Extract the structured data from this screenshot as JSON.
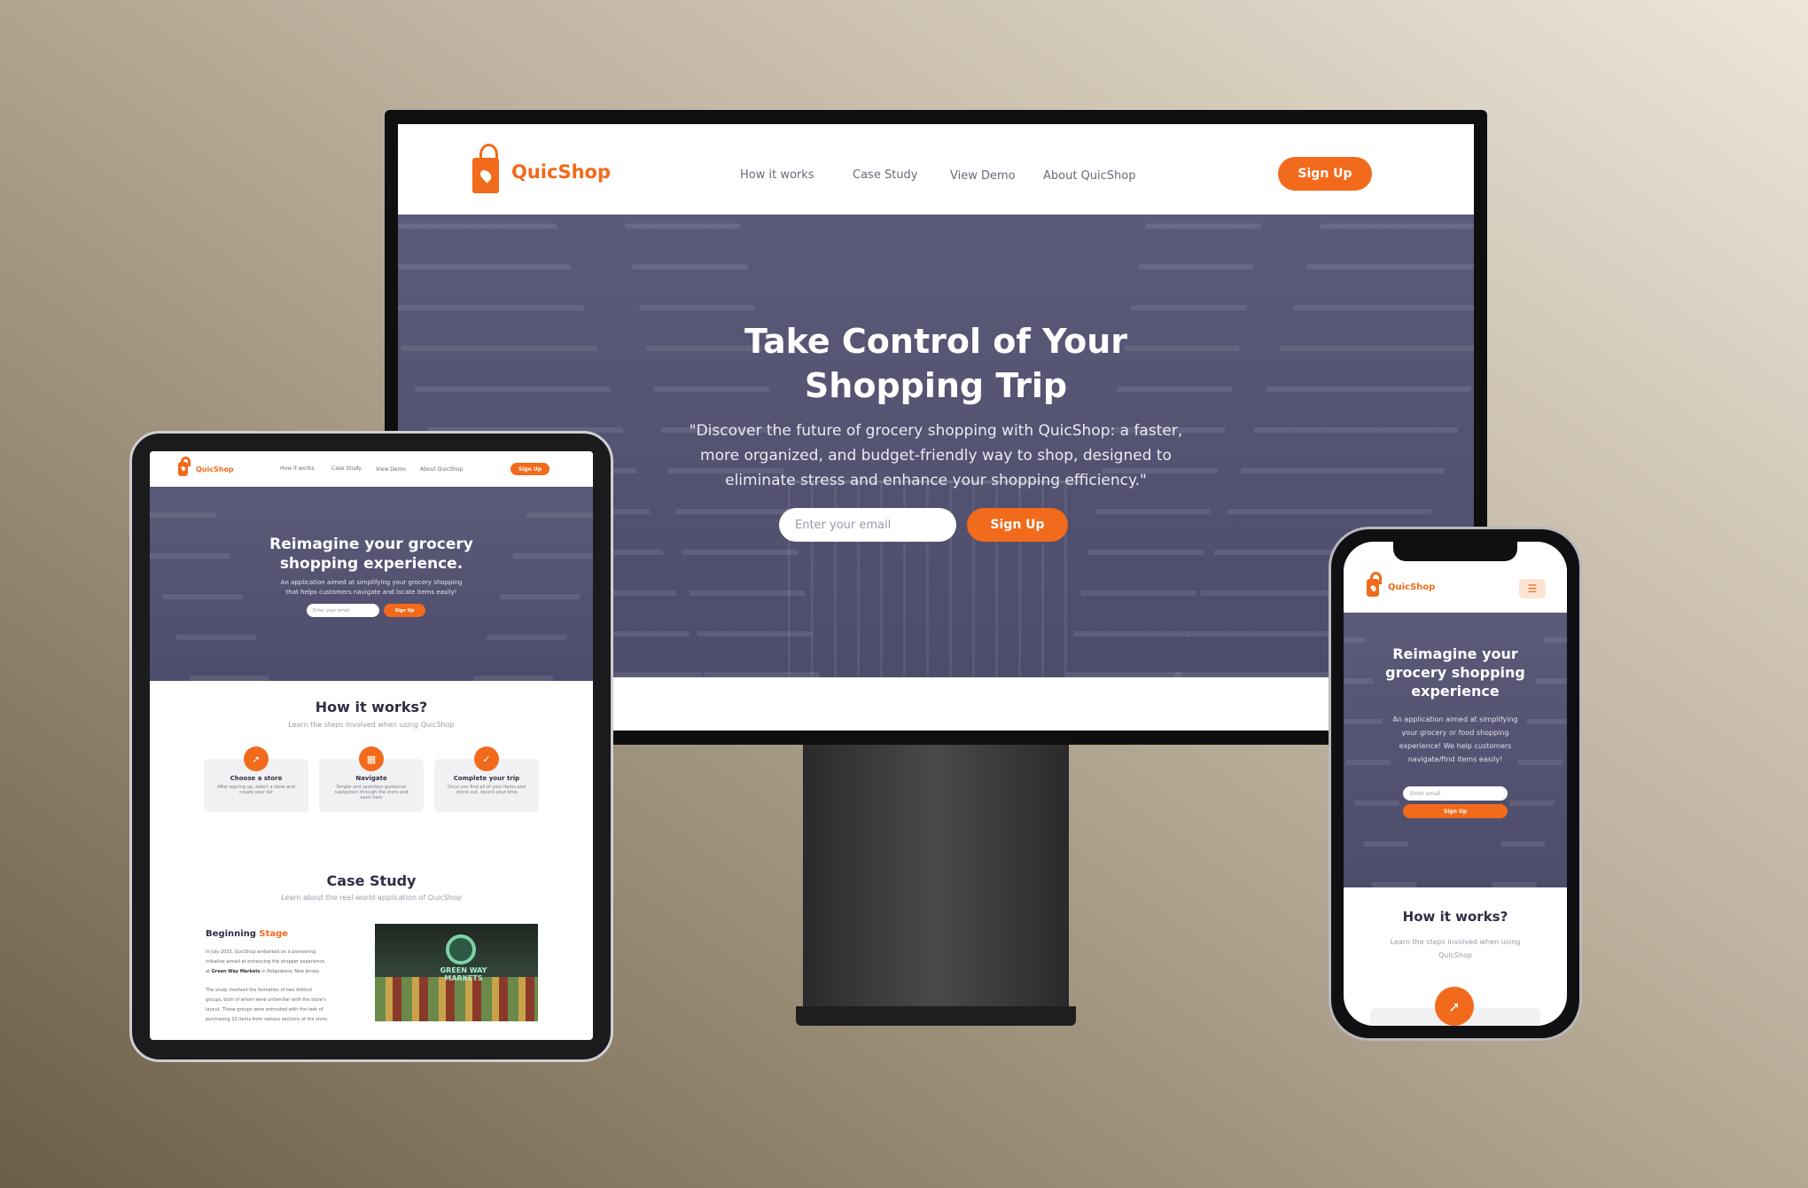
{
  "brand": {
    "name": "QuicShop"
  },
  "desktop": {
    "nav": [
      "How it works",
      "Case Study",
      "View Demo",
      "About QuicShop"
    ],
    "signup": "Sign Up",
    "hero": {
      "title_line1": "Take Control of Your",
      "title_line2": "Shopping Trip",
      "line1": "\"Discover the future of grocery shopping with QuicShop: a faster,",
      "line2": "more organized, and budget-friendly way to shop, designed to",
      "line3": "eliminate stress and enhance your shopping efficiency.\"",
      "email_placeholder": "Enter your email",
      "cta": "Sign Up"
    }
  },
  "tablet": {
    "nav": [
      "How it works",
      "Case Study",
      "View Demo",
      "About QuicShop"
    ],
    "signup": "Sign Up",
    "hero": {
      "title_line1": "Reimagine your grocery",
      "title_line2": "shopping experience.",
      "sub_line1": "An application aimed at simplifying your grocery shopping",
      "sub_line2": "that helps customers navigate and locate items easily!",
      "email_placeholder": "Enter your email",
      "cta": "Sign Up"
    },
    "how": {
      "title": "How it works?",
      "subtitle": "Learn the steps involved when using QuicShop",
      "cards": [
        {
          "title": "Choose a store",
          "line1": "After signing up, select a store and",
          "line2": "create your list"
        },
        {
          "title": "Navigate",
          "line1": "Simple and seamless guidance/",
          "line2": "navigation through the store and",
          "line3": "each item"
        },
        {
          "title": "Complete your trip",
          "line1": "Once you find all of your items and",
          "line2": "check out, record your time"
        }
      ]
    },
    "case": {
      "title": "Case Study",
      "subtitle": "Learn about the real-world application of QuicShop",
      "heading_a": "Beginning",
      "heading_b": "Stage",
      "p1_l1": "In July 2023, QuicShop embarked on a pioneering",
      "p1_l2": "initiative aimed at enhancing the shopper experience",
      "p1_l3_bold": "Green Way Markets",
      "p1_l3_pre": "at ",
      "p1_l3_post": " in Ridgewood, New Jersey.",
      "p2_l1": "The study involved the formation of two distinct",
      "p2_l2": "groups, both of whom were unfamiliar with the store's",
      "p2_l3": "layout. These groups were entrusted with the task of",
      "p2_l4": "purchasing 15 items from various sections of the store.",
      "store_sign": "GREEN WAY MARKETS"
    }
  },
  "phone": {
    "hero": {
      "title_line1": "Reimagine your",
      "title_line2": "grocery shopping",
      "title_line3": "experience",
      "sub_line1": "An application aimed at simplifying",
      "sub_line2": "your grocery or food shopping",
      "sub_line3": "experience! We help customers",
      "sub_line4": "navigate/find items easily!",
      "email_placeholder": "Enter email",
      "cta": "Sign Up"
    },
    "how": {
      "title": "How it works?",
      "sub_line1": "Learn the steps involved when using",
      "sub_line2": "QuicShop"
    }
  },
  "colors": {
    "accent": "#f26a1b",
    "hero_overlay": "#4d4c6b",
    "text_dark": "#2f2f45"
  }
}
